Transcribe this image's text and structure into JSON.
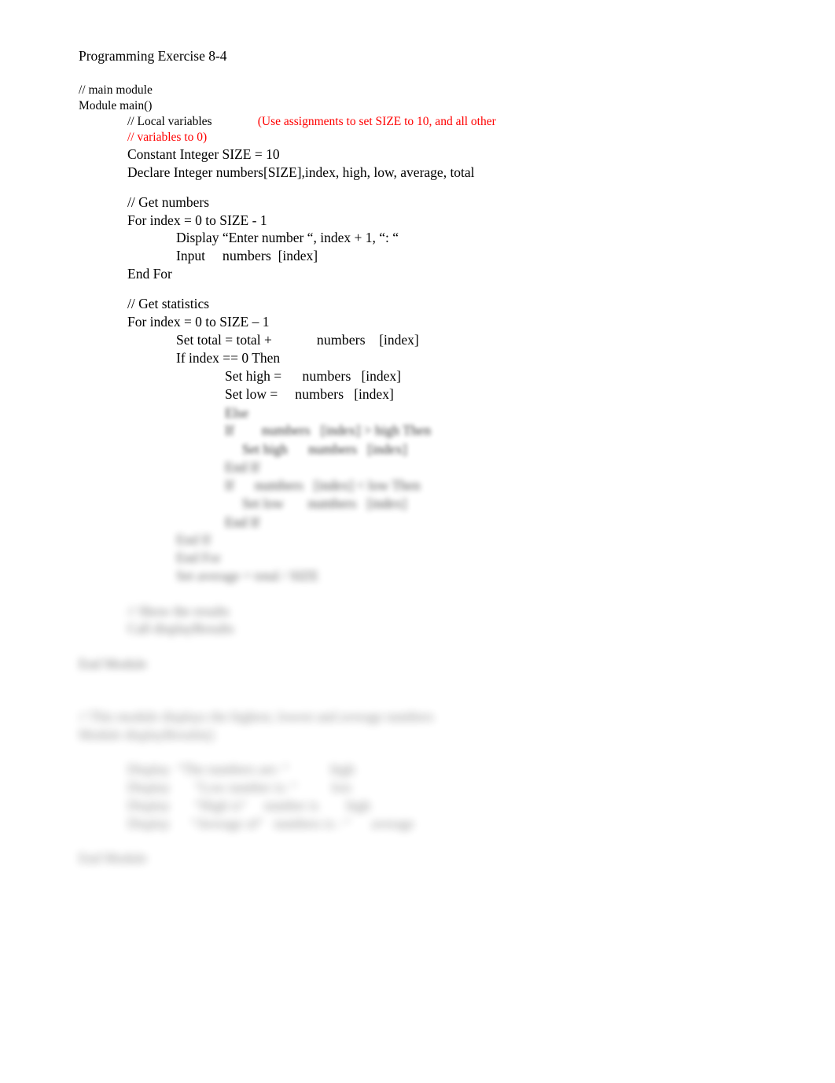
{
  "document": {
    "title": "Programming Exercise 8-4",
    "accent_red": "#ff0000",
    "background": "#ffffff",
    "text_color": "#000000"
  },
  "clear_section": {
    "comment_main_module": "// main module",
    "module_decl": "Module main()",
    "local_variables_comment": "// Local variables",
    "annotation_line1": "(Use assignments to set SIZE to 10, and all other",
    "annotation_line2": "// variables to 0)",
    "constant_decl": "Constant Integer SIZE = 10",
    "declare_decl": "Declare Integer numbers[SIZE],index, high, low, average, total",
    "comment_get_numbers": "// Get numbers",
    "for_loop_1": "For index = 0 to SIZE - 1",
    "display_enter_number": "Display “Enter number “, index + 1, “: “",
    "input_label": "Input",
    "input_numbers": "numbers",
    "input_index": "[index]",
    "end_for_1": "End For",
    "comment_get_statistics": "// Get statistics",
    "for_loop_2": "For index = 0 to SIZE – 1",
    "set_total_label": "Set total = total +",
    "set_total_numbers": "numbers",
    "set_total_index": "[index]",
    "if_index_zero": "If index == 0 Then",
    "set_high_label": "Set high =",
    "set_high_numbers": "numbers",
    "set_high_index": "[index]",
    "set_low_label": "Set low =",
    "set_low_numbers": "numbers",
    "set_low_index": "[index]"
  },
  "blurred_section": {
    "note": "Lower portion of the page is visually blurred / obscured in the source image; glyph shapes are indistinct.",
    "b1_else": "Else",
    "b2_if_high": "If",
    "b2_if_high_numbers": "numbers",
    "b2_if_high_cond": "[index] > high Then",
    "b3_set_high": "Set high",
    "b3_set_high_numbers": "numbers",
    "b3_set_high_index": "[index]",
    "b4_end_if": "End If",
    "b5_if_low": "If",
    "b5_if_low_numbers": "numbers",
    "b5_if_low_cond": "[index] < low Then",
    "b6_set_low": "Set low",
    "b6_set_low_numbers": "numbers",
    "b6_set_low_index": "[index]",
    "b7_end_if": "End If",
    "b8_end_if_outer": "End If",
    "b9_end_for": "End For",
    "b10_set_average": "Set average = total / SIZE",
    "b11_call_comment": "// Show the results",
    "b12_call_display": "Call displayResults",
    "b13_end_module": "End Module",
    "b14_comment_1": "// This module displays the highest, lowest and average numbers",
    "b14_comment_2": "Module displayResults()",
    "b15_row1_label": "Display",
    "b15_row1_text": "“The numbers are: “",
    "b15_row1_val": "high",
    "b16_row2_label": "Display",
    "b16_row2_text": "“Low number is: “",
    "b16_row2_val": "low",
    "b17_row3_label": "Display",
    "b17_row3_text": "“High is“",
    "b17_row3_mid": "number is",
    "b17_row3_val": "high",
    "b18_row4_label": "Display",
    "b18_row4_text": "“Average of“",
    "b18_row4_mid": "numbers is : “",
    "b18_row4_val": "average",
    "b19_end_module": "End Module"
  }
}
